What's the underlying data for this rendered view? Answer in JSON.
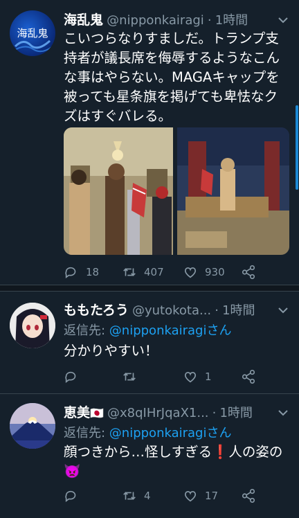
{
  "tweets": [
    {
      "name": "海乱鬼",
      "handle": "@nipponkairagi",
      "dot": "·",
      "time": "1時間",
      "avatar_text": "海乱鬼",
      "body_lines": [
        "こいつらなりすましだ。トランプ支",
        "持者が議長席を侮辱するようなこん",
        "な事はやらない。MAGAキャップを",
        "被っても星条旗を掲げても卑怯なク",
        "ズはすぐバレる。"
      ],
      "replies": "18",
      "retweets": "407",
      "likes": "930"
    },
    {
      "name": "ももたろう",
      "handle": "@yutokota...",
      "dot": "·",
      "time": "1時間",
      "reply_prefix": "返信先: ",
      "reply_mention": "@nipponkairagi",
      "reply_suffix": "さん",
      "body": "分かりやすい！",
      "replies": "",
      "retweets": "",
      "likes": "1"
    },
    {
      "name": "恵美",
      "flag": "🇯🇵",
      "handle": "@x8qIHrJqaX1...",
      "dot": "·",
      "time": "1時間",
      "reply_prefix": "返信先: ",
      "reply_mention": "@nipponkairagi",
      "reply_suffix": "さん",
      "body_line1": "顔つきから…怪しすぎる",
      "exclaim": "❗",
      "body_line1_tail": "人の姿の",
      "emoji": "👿",
      "replies": "",
      "retweets": "4",
      "likes": "17"
    }
  ],
  "colors": {
    "background": "#15202b",
    "secondary_text": "#8899a6",
    "accent": "#1da1f2"
  }
}
